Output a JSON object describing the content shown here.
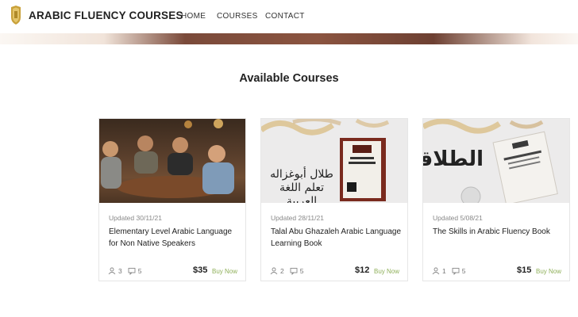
{
  "header": {
    "brand": "ARABIC FLUENCY COURSES",
    "nav": [
      "HOME",
      "COURSES",
      "CONTACT"
    ],
    "logo_icon": "gold-crest-icon",
    "colors": {
      "accent": "#8fb05a",
      "brand_gold": "#c9a13a",
      "banner": "#7a4a3a"
    }
  },
  "section": {
    "title": "Available Courses"
  },
  "courses": [
    {
      "updated": "Updated 30/11/21",
      "title": "Elementary Level Arabic Language for Non Native Speakers",
      "students": "3",
      "comments": "5",
      "price": "$35",
      "buy_label": "Buy Now",
      "image": "group-of-men-photo"
    },
    {
      "updated": "Updated 28/11/21",
      "title": "Talal Abu Ghazaleh Arabic Language Learning Book",
      "students": "2",
      "comments": "5",
      "price": "$12",
      "buy_label": "Buy Now",
      "image": "arabic-book-cover",
      "image_text": "طلال أبوغزاله تعلم اللغة العربية"
    },
    {
      "updated": "Updated 5/08/21",
      "title": "The Skills in Arabic Fluency Book",
      "students": "1",
      "comments": "5",
      "price": "$15",
      "buy_label": "Buy Now",
      "image": "arabic-book-cover",
      "image_text": "الطلاقة"
    }
  ]
}
